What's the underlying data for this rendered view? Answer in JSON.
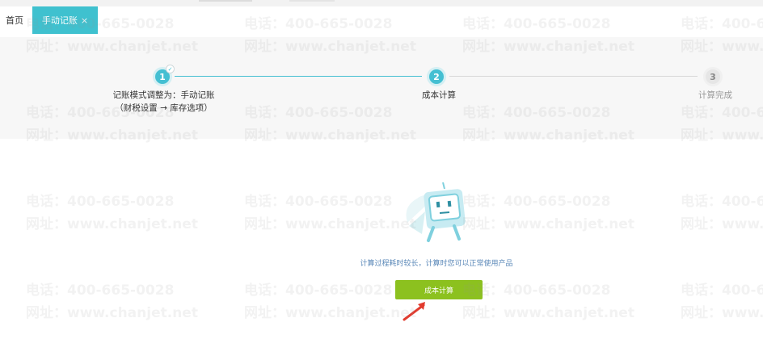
{
  "tabs": {
    "home_label": "首页",
    "active_label": "手动记账",
    "close_symbol": "×"
  },
  "steps": [
    {
      "number": "1",
      "label_line1": "记账模式调整为：手动记账",
      "label_line2": "（财税设置 → 库存选项）",
      "state": "done"
    },
    {
      "number": "2",
      "label": "成本计算",
      "state": "current"
    },
    {
      "number": "3",
      "label": "计算完成",
      "state": "pending"
    }
  ],
  "main": {
    "hint": "计算过程耗时较长，计算时您可以正常使用产品",
    "button_label": "成本计算"
  },
  "watermark": {
    "phone": "电话：400-665-0028",
    "site": "网址：www.chanjet.net"
  },
  "colors": {
    "accent": "#3fc1cf",
    "button": "#8cc11f",
    "arrow": "#e23b2e"
  },
  "icons": [
    "check-icon",
    "robot-illustration",
    "red-arrow-annotation",
    "close-icon"
  ]
}
